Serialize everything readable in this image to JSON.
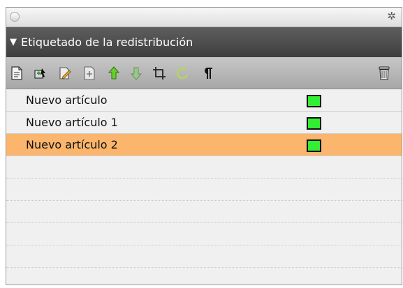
{
  "panel": {
    "title": "Etiquetado de la redistribución",
    "toolbar": [
      {
        "name": "new-article-icon"
      },
      {
        "name": "add-to-article-icon"
      },
      {
        "name": "edit-article-icon"
      },
      {
        "name": "add-element-icon"
      },
      {
        "name": "move-up-icon"
      },
      {
        "name": "move-down-icon"
      },
      {
        "name": "crop-frame-icon"
      },
      {
        "name": "refresh-icon"
      },
      {
        "name": "paragraph-icon"
      },
      {
        "name": "trash-icon"
      }
    ],
    "articles": [
      {
        "label": "Nuevo artículo",
        "color": "#33ee33",
        "selected": false
      },
      {
        "label": "Nuevo artículo 1",
        "color": "#33ee33",
        "selected": false
      },
      {
        "label": "Nuevo artículo 2",
        "color": "#33ee33",
        "selected": true
      }
    ],
    "selection_color": "#fbb56c",
    "header_color": "#4a4a4a"
  }
}
